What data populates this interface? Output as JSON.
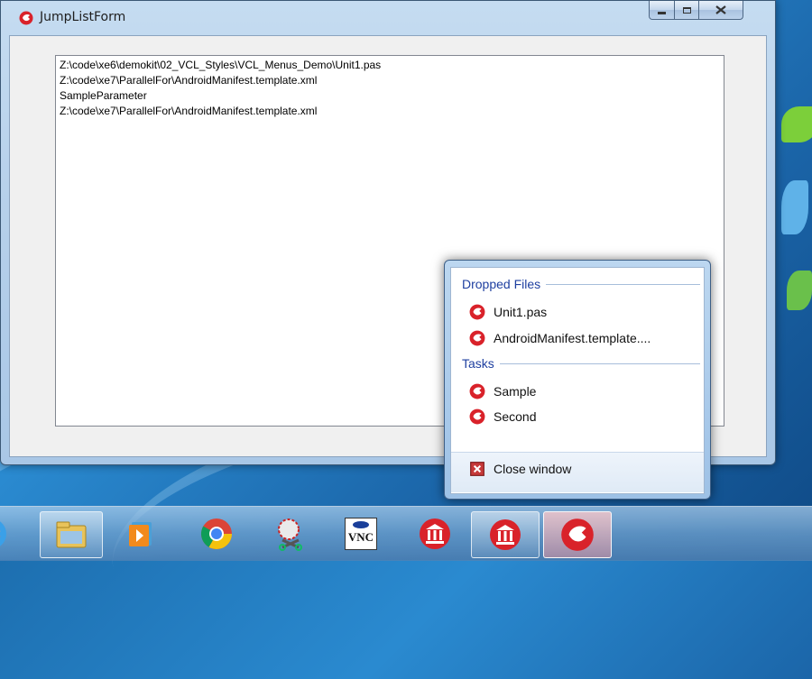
{
  "window": {
    "title": "JumpListForm",
    "controls": {
      "minimize": "minimize-icon",
      "maximize": "maximize-icon",
      "close": "close-icon"
    }
  },
  "memo": {
    "lines": [
      "Z:\\code\\xe6\\demokit\\02_VCL_Styles\\VCL_Menus_Demo\\Unit1.pas",
      "Z:\\code\\xe7\\ParallelFor\\AndroidManifest.template.xml",
      "SampleParameter",
      "Z:\\code\\xe7\\ParallelFor\\AndroidManifest.template.xml"
    ]
  },
  "jumplist": {
    "groups": [
      {
        "header": "Dropped Files",
        "items": [
          {
            "label": "Unit1.pas"
          },
          {
            "label": "AndroidManifest.template...."
          }
        ]
      },
      {
        "header": "Tasks",
        "items": [
          {
            "label": "Sample"
          },
          {
            "label": "Second"
          }
        ]
      }
    ],
    "close_label": "Close window"
  },
  "taskbar": {
    "items": [
      {
        "icon": "internet-explorer-icon"
      },
      {
        "icon": "windows-explorer-icon"
      },
      {
        "icon": "media-player-icon"
      },
      {
        "icon": "chrome-icon"
      },
      {
        "icon": "snipping-tool-icon"
      },
      {
        "icon": "vnc-icon"
      },
      {
        "icon": "red-building-app-icon"
      },
      {
        "icon": "red-building-app-icon"
      },
      {
        "icon": "delphi-app-icon"
      }
    ],
    "vnc_text": "VNC"
  },
  "colors": {
    "accent": "#1e3fa0",
    "app_icon": "#d9222a"
  }
}
